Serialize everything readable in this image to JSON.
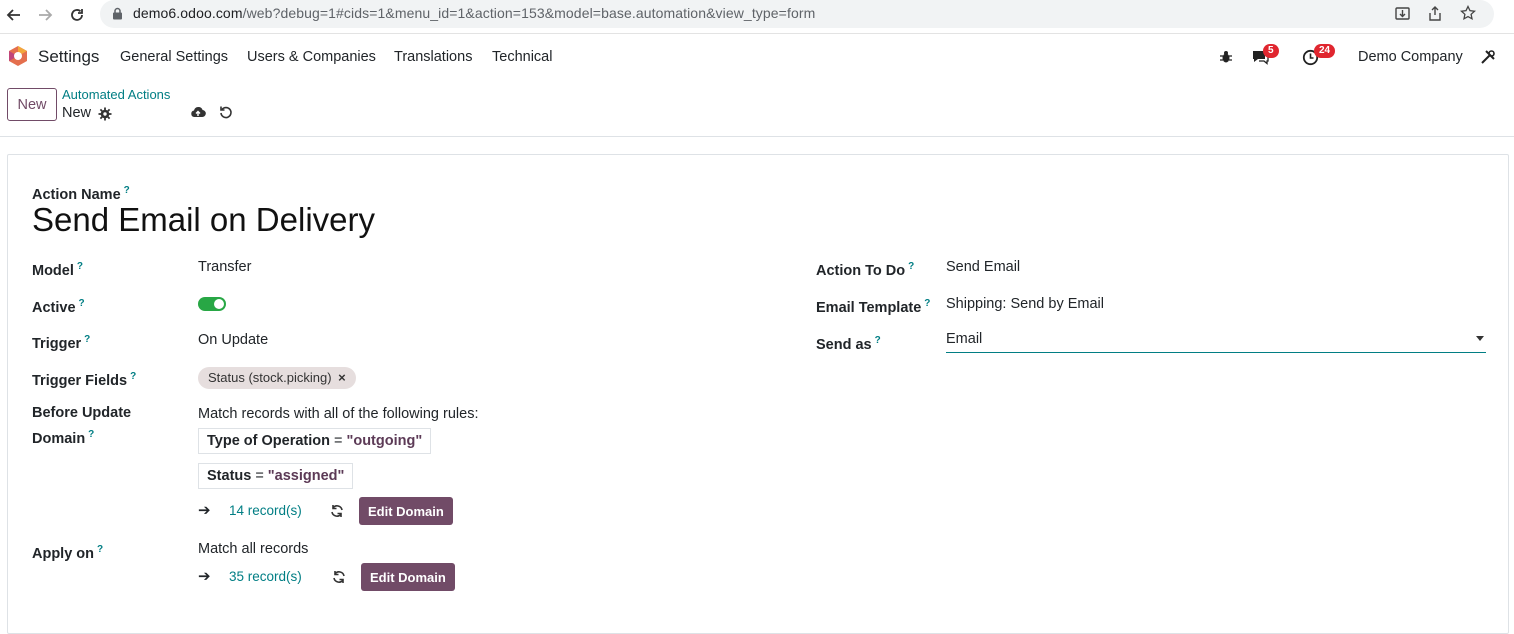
{
  "browser": {
    "url_host": "demo6.odoo.com",
    "url_rest": "/web?debug=1#cids=1&menu_id=1&action=153&model=base.automation&view_type=form"
  },
  "navbar": {
    "app_name": "Settings",
    "menu": [
      "General Settings",
      "Users & Companies",
      "Translations",
      "Technical"
    ],
    "messages_count": "5",
    "activities_count": "24",
    "company": "Demo Company"
  },
  "control_panel": {
    "new_label": "New",
    "breadcrumb": "Automated Actions",
    "record_name": "New"
  },
  "form": {
    "action_name_label": "Action Name",
    "action_name": "Send Email on Delivery",
    "model_label": "Model",
    "model_value": "Transfer",
    "active_label": "Active",
    "active_value": true,
    "trigger_label": "Trigger",
    "trigger_value": "On Update",
    "trigger_fields_label": "Trigger Fields",
    "trigger_fields_tag": "Status (stock.picking)",
    "before_update_label_1": "Before Update",
    "before_update_label_2": "Domain",
    "before_match_pre": "Match records with ",
    "before_match_all": "all",
    "before_match_post": " of the following rules:",
    "rules": [
      {
        "field": "Type of Operation",
        "op": "=",
        "value": "\"outgoing\""
      },
      {
        "field": "Status",
        "op": "=",
        "value": "\"assigned\""
      }
    ],
    "before_records": "14 record(s)",
    "edit_domain_label": "Edit Domain",
    "apply_on_label": "Apply on",
    "apply_match_pre": "Match ",
    "apply_match_all": "all",
    "apply_match_post": " records",
    "apply_records": "35 record(s)",
    "action_to_do_label": "Action To Do",
    "action_to_do_value": "Send Email",
    "email_template_label": "Email Template",
    "email_template_value": "Shipping: Send by Email",
    "send_as_label": "Send as",
    "send_as_value": "Email",
    "help_mark": "?"
  },
  "colors": {
    "brand": "#714b67",
    "link": "#017e84",
    "toggle_on": "#28a745",
    "badge": "#e0262f"
  }
}
